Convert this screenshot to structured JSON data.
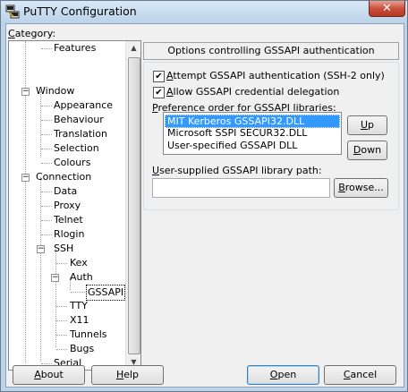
{
  "window": {
    "title": "PuTTY Configuration",
    "close_glyph": "✕"
  },
  "category_label": "Category:",
  "tree": [
    {
      "label": "Features"
    },
    {
      "label": "Window"
    },
    {
      "label": "Appearance"
    },
    {
      "label": "Behaviour"
    },
    {
      "label": "Translation"
    },
    {
      "label": "Selection"
    },
    {
      "label": "Colours"
    },
    {
      "label": "Connection"
    },
    {
      "label": "Data"
    },
    {
      "label": "Proxy"
    },
    {
      "label": "Telnet"
    },
    {
      "label": "Rlogin"
    },
    {
      "label": "SSH"
    },
    {
      "label": "Kex"
    },
    {
      "label": "Auth"
    },
    {
      "label": "GSSAPI"
    },
    {
      "label": "TTY"
    },
    {
      "label": "X11"
    },
    {
      "label": "Tunnels"
    },
    {
      "label": "Bugs"
    },
    {
      "label": "Serial"
    }
  ],
  "panel": {
    "header": "Options controlling GSSAPI authentication",
    "attempt_label": "Attempt GSSAPI authentication (SSH-2 only)",
    "attempt_checked": true,
    "delegation_label": "Allow GSSAPI credential delegation",
    "delegation_checked": true,
    "pref_label": "Preference order for GSSAPI libraries:",
    "libraries": [
      "MIT Kerberos GSSAPI32.DLL",
      "Microsoft SSPI SECUR32.DLL",
      "User-specified GSSAPI DLL"
    ],
    "selected_library": "MIT Kerberos GSSAPI32.DLL",
    "up_label": "Up",
    "down_label": "Down",
    "path_label": "User-supplied GSSAPI library path:",
    "path_value": "",
    "browse_label": "Browse..."
  },
  "footer": {
    "about": "About",
    "help": "Help",
    "open": "Open",
    "cancel": "Cancel"
  },
  "icons": {
    "app": "putty-icon",
    "checkbox": "checkmark-icon",
    "expander": "minus-icon"
  }
}
